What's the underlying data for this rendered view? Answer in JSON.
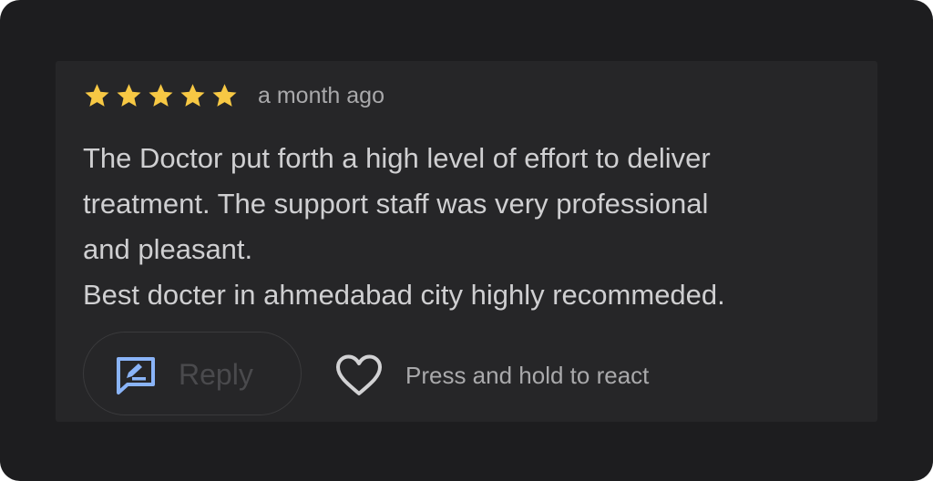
{
  "review": {
    "rating": 5,
    "rating_max": 5,
    "time_ago": "a month ago",
    "text": "The Doctor put forth a high level of effort to deliver\ntreatment. The support staff was very professional\nand pleasant.\nBest docter in ahmedabad city highly recommeded."
  },
  "actions": {
    "reply_label": "Reply",
    "react_hint": "Press and hold to react",
    "reply_icon": "reply-icon",
    "react_icon": "heart-icon"
  },
  "colors": {
    "star": "#f7c844",
    "reply_icon": "#8ab4f8",
    "background": "#1d1d1f",
    "card": "#262628"
  }
}
